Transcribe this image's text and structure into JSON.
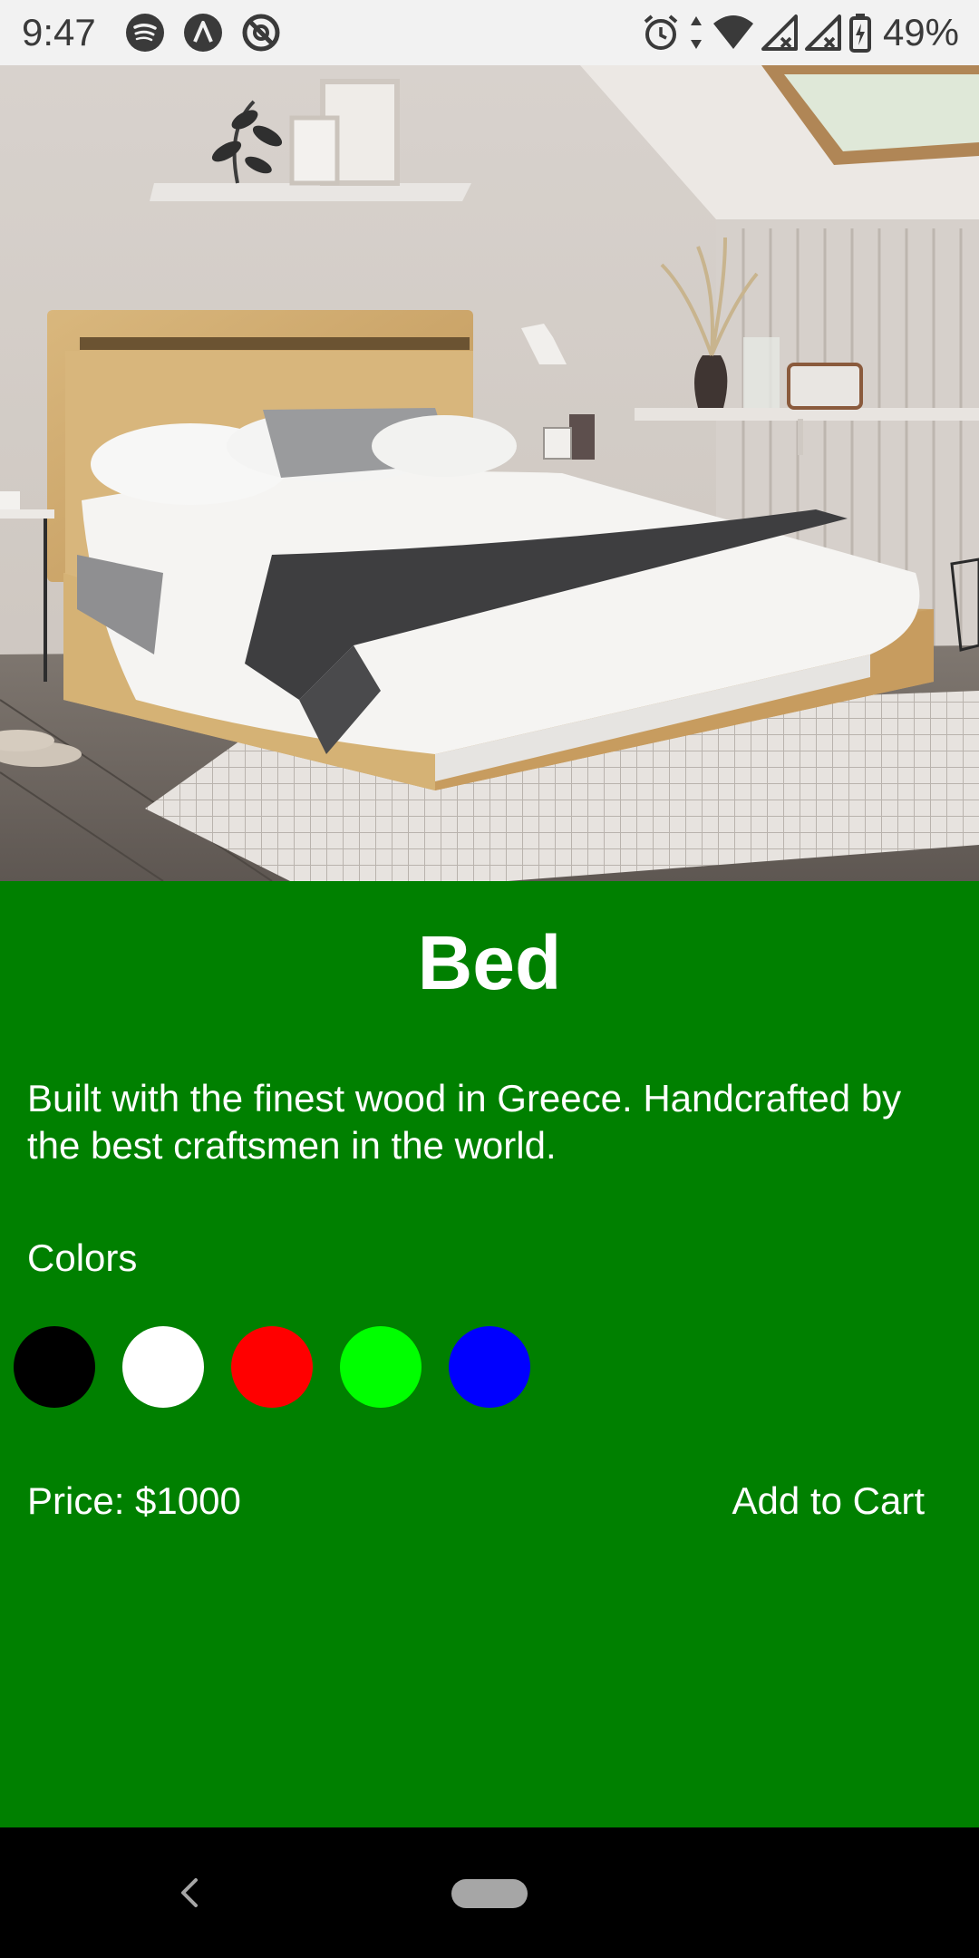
{
  "status_bar": {
    "time": "9:47",
    "battery": "49%",
    "left_icons": [
      "spotify-icon",
      "app-icon",
      "do-not-disturb-icon"
    ],
    "right_icons": [
      "alarm-icon",
      "data-arrows-icon",
      "wifi-icon",
      "signal-icon",
      "signal-icon",
      "battery-icon"
    ]
  },
  "product": {
    "image_icon": "bed-photo",
    "title": "Bed",
    "description": "Built with the finest wood in Greece. Handcrafted by the best craftsmen in the world.",
    "colors_label": "Colors",
    "colors": [
      "#000000",
      "#ffffff",
      "#ff0000",
      "#00ff00",
      "#0000ff"
    ],
    "price": "Price: $1000",
    "add_to_cart": "Add to Cart"
  },
  "theme": {
    "background": "#008000",
    "text": "#ffffff"
  },
  "nav_bar": {
    "icons": [
      "back-icon",
      "home-pill-icon"
    ]
  }
}
